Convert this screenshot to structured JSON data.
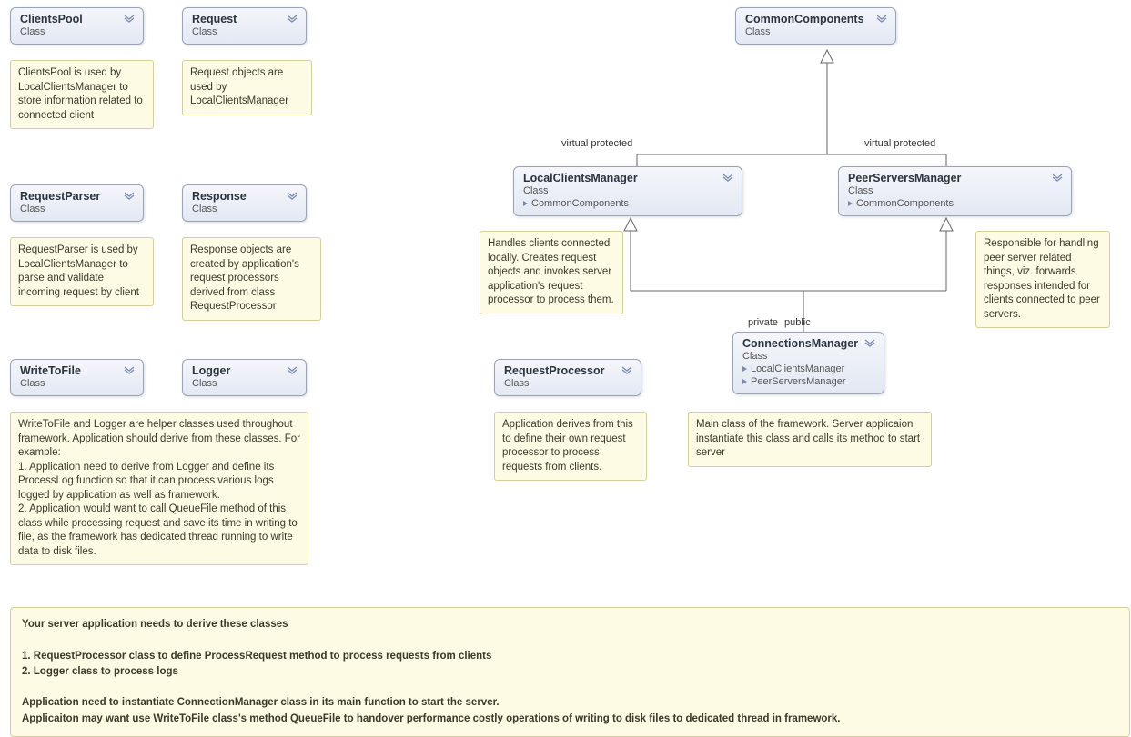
{
  "classes": {
    "clientsPool": {
      "name": "ClientsPool",
      "stereotype": "Class"
    },
    "request": {
      "name": "Request",
      "stereotype": "Class"
    },
    "requestParser": {
      "name": "RequestParser",
      "stereotype": "Class"
    },
    "response": {
      "name": "Response",
      "stereotype": "Class"
    },
    "writeToFile": {
      "name": "WriteToFile",
      "stereotype": "Class"
    },
    "logger": {
      "name": "Logger",
      "stereotype": "Class"
    },
    "commonComponents": {
      "name": "CommonComponents",
      "stereotype": "Class"
    },
    "localClientsManager": {
      "name": "LocalClientsManager",
      "stereotype": "Class",
      "members": [
        "CommonComponents"
      ]
    },
    "peerServersManager": {
      "name": "PeerServersManager",
      "stereotype": "Class",
      "members": [
        "CommonComponents"
      ]
    },
    "requestProcessor": {
      "name": "RequestProcessor",
      "stereotype": "Class"
    },
    "connectionsManager": {
      "name": "ConnectionsManager",
      "stereotype": "Class",
      "members": [
        "LocalClientsManager",
        "PeerServersManager"
      ]
    }
  },
  "notes": {
    "clientsPool": "ClientsPool is used by LocalClientsManager to store information related to connected client",
    "request": "Request objects are used by LocalClientsManager",
    "requestParser": "RequestParser is used by LocalClientsManager to parse and validate incoming request by client",
    "response": "Response objects are created by application's request processors derived from class RequestProcessor",
    "writeLogger": "WriteToFile and Logger are helper classes used throughout framework. Application should derive from these classes. For example:\n1. Application need to derive from Logger and define its ProcessLog function so that it can process various logs logged by application as well as framework.\n2. Application would want to call QueueFile method of this class while processing request and save its time in writing to file, as the framework has dedicated thread running to write data to disk files.",
    "localClientsManager": "Handles clients connected locally. Creates request objects and invokes server application's request processor to process them.",
    "peerServersManager": "Responsible for handling peer server related things, viz. forwards responses intended for clients connected to peer servers.",
    "requestProcessor": "Application derives from this to define their own request processor to process requests from clients.",
    "connectionsManager": "Main class of the framework. Server applicaion instantiate this class and calls its method to start server"
  },
  "edgeLabels": {
    "lcmInherit": "virtual protected",
    "psmInherit": "virtual protected",
    "cmToLcm": "private",
    "cmToPsm": "public"
  },
  "bigNote": {
    "line1": "Your server application needs to derive these classes",
    "item1": "1. RequestProcessor class to define ProcessRequest method to process requests from clients",
    "item2": "2. Logger class to process logs",
    "line2": "Application need to instantiate ConnectionManager class in its main function to start the server.",
    "line3": "Applicaiton may want use WriteToFile class's method QueueFile to handover performance costly operations of writing to disk files to dedicated thread in framework."
  }
}
